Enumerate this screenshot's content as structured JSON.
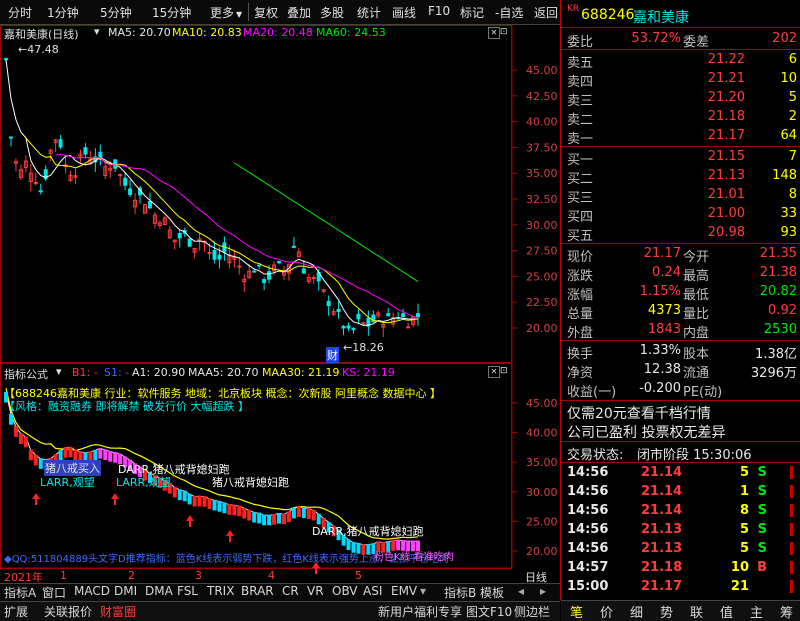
{
  "toolbar": {
    "left": [
      "分时",
      "1分钟",
      "5分钟",
      "15分钟",
      "更多"
    ],
    "right": [
      "复权",
      "叠加",
      "多股",
      "统计",
      "画线",
      "F10",
      "标记",
      "-自选",
      "返回"
    ]
  },
  "main": {
    "stock_title": "嘉和美康(日线)",
    "ma5": "MA5: 20.70",
    "ma10": "MA10: 20.83",
    "ma20": "MA20: 20.48",
    "ma60": "MA60: 24.53",
    "high_label": "47.48",
    "low_label": "18.26",
    "cai_label": "财",
    "price_axis": [
      "45.00",
      "42.50",
      "40.00",
      "37.50",
      "35.00",
      "32.50",
      "30.00",
      "27.50",
      "25.00",
      "22.50",
      "20.00"
    ]
  },
  "indicator": {
    "name": "指标公式",
    "b1": "B1: -",
    "s1": "S1: -",
    "a1": "A1: 20.90",
    "maa5": "MAA5: 20.70",
    "maa30": "MAA30: 21.19",
    "ks": "KS: 21.19",
    "info_line1": "【688246嘉和美康 行业：软件服务 地域：北京板块 概念：次新股 阿里概念 数据中心 】",
    "info_line2": "【风格：融资融券 即将解禁 破发行价 大幅超跌 】",
    "annot_larr1": "LARR,观望",
    "annot_larr2": "LARR,观望",
    "annot_fang": "猪八戒买入",
    "annot_darr": "DARR,猪八戒背媳妇跑",
    "annot_zhu2": "猪八戒背媳妇跑",
    "annot_zhu3": "DARR,猪八戒背媳妇跑",
    "annot_bottom": "◆QQ:511804889头文字D推荐指标：蓝色K线表示弱势下跌，红色K线表示强势上涨，止损平仓吃肉",
    "annot_bottom_right": "粉色K线 看准吃肉",
    "axis": [
      "45.00",
      "40.00",
      "35.00",
      "30.00",
      "25.00",
      "20.00"
    ],
    "x_labels": [
      "2021年",
      "1",
      "2",
      "3",
      "4",
      "5"
    ],
    "period": "日线"
  },
  "tabs1": [
    "指标A",
    "窗口",
    "MACD",
    "DMI",
    "DMA",
    "FSL",
    "TRIX",
    "BRAR",
    "CR",
    "VR",
    "OBV",
    "ASI",
    "EMV",
    "指标B",
    "模板"
  ],
  "tabs2": [
    "扩展",
    "关联报价",
    "财富圈"
  ],
  "tabs2_right": [
    "新用户福利专享",
    "图文F10",
    "侧边栏"
  ],
  "panel": {
    "code": "688246",
    "name": "嘉和美康",
    "weibi_label": "委比",
    "weibi": "53.72%",
    "weicha_label": "委差",
    "weicha": "202",
    "asks": [
      {
        "label": "卖五",
        "price": "21.22",
        "vol": "6"
      },
      {
        "label": "卖四",
        "price": "21.21",
        "vol": "10"
      },
      {
        "label": "卖三",
        "price": "21.20",
        "vol": "5"
      },
      {
        "label": "卖二",
        "price": "21.18",
        "vol": "2"
      },
      {
        "label": "卖一",
        "price": "21.17",
        "vol": "64"
      }
    ],
    "bids": [
      {
        "label": "买一",
        "price": "21.15",
        "vol": "7"
      },
      {
        "label": "买二",
        "price": "21.13",
        "vol": "148"
      },
      {
        "label": "买三",
        "price": "21.01",
        "vol": "8"
      },
      {
        "label": "买四",
        "price": "21.00",
        "vol": "33"
      },
      {
        "label": "买五",
        "price": "20.98",
        "vol": "93"
      }
    ],
    "quote": [
      {
        "l1": "现价",
        "v1": "21.17",
        "l2": "今开",
        "v2": "21.35"
      },
      {
        "l1": "涨跌",
        "v1": "0.24",
        "l2": "最高",
        "v2": "21.38"
      },
      {
        "l1": "涨幅",
        "v1": "1.15%",
        "l2": "最低",
        "v2": "20.82"
      },
      {
        "l1": "总量",
        "v1": "4373",
        "l2": "量比",
        "v2": "0.92"
      },
      {
        "l1": "外盘",
        "v1": "1843",
        "l2": "内盘",
        "v2": "2530"
      }
    ],
    "stats": [
      {
        "l1": "换手",
        "v1": "1.33%",
        "l2": "股本",
        "v2": "1.38亿"
      },
      {
        "l1": "净资",
        "v1": "12.38",
        "l2": "流通",
        "v2": "3296万"
      },
      {
        "l1": "收益(一)",
        "v1": "-0.200",
        "l2": "PE(动)",
        "v2": ""
      }
    ],
    "notice1": "仅需20元查看千档行情",
    "notice2": "公司已盈利 投票权无差异",
    "status_label": "交易状态:",
    "status": "闭市阶段 15:30:06",
    "ticks": [
      {
        "t": "14:56",
        "p": "21.14",
        "v": "5",
        "d": "S"
      },
      {
        "t": "14:56",
        "p": "21.14",
        "v": "1",
        "d": "S"
      },
      {
        "t": "14:56",
        "p": "21.14",
        "v": "8",
        "d": "S"
      },
      {
        "t": "14:56",
        "p": "21.13",
        "v": "5",
        "d": "S"
      },
      {
        "t": "14:56",
        "p": "21.13",
        "v": "5",
        "d": "S"
      },
      {
        "t": "14:57",
        "p": "21.18",
        "v": "10",
        "d": "B"
      },
      {
        "t": "15:00",
        "p": "21.17",
        "v": "21",
        "d": ""
      }
    ],
    "bottom_tabs": [
      "笔",
      "价",
      "细",
      "势",
      "联",
      "值",
      "主",
      "筹"
    ]
  },
  "colors": {
    "up": "#ff3c3c",
    "down": "#00e600",
    "ma5": "#ffffff",
    "ma10": "#ffff00",
    "ma20": "#ff00ff",
    "ma60": "#00e600",
    "axis": "#a00000"
  }
}
